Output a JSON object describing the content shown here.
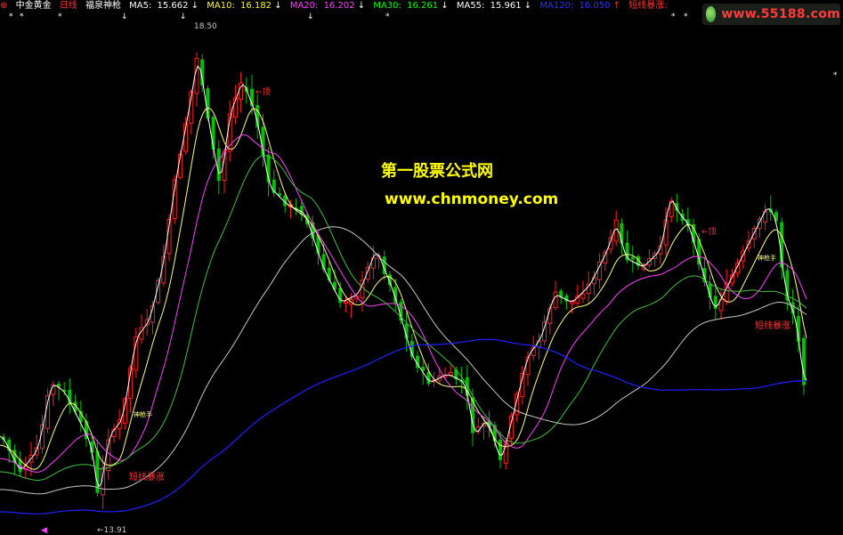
{
  "header": {
    "marker": "⊕",
    "stock_name": "中金黄金",
    "period": "日线",
    "indicator_name": "福泉神枪",
    "ma": [
      {
        "label": "MA5:",
        "value": "15.662",
        "arrow": "↓",
        "color": "#ffffff"
      },
      {
        "label": "MA10:",
        "value": "16.182",
        "arrow": "↓",
        "color": "#ffff00"
      },
      {
        "label": "MA20:",
        "value": "16.202",
        "arrow": "↓",
        "color": "#ff40ff"
      },
      {
        "label": "MA30:",
        "value": "16.261",
        "arrow": "↓",
        "color": "#00ff00"
      },
      {
        "label": "MA55:",
        "value": "15.961",
        "arrow": "↓",
        "color": "#d0d0d0"
      },
      {
        "label": "MA120:",
        "value": "16.050",
        "arrow": "↑",
        "color": "#3030ff"
      }
    ],
    "signal": "短线暴涨:"
  },
  "logo": {
    "text": "www.55188.com"
  },
  "watermark": {
    "title": "第一股票公式网",
    "url": "www.chnmoney.com"
  },
  "annotations": {
    "high_price": "18.50",
    "low_price": "←13.91",
    "top_label_1": "←顶",
    "top_label_2": "←顶",
    "surge_label_1": "短线暴涨",
    "surge_label_2": "短线暴涨",
    "gun_label_1": "神枪手",
    "gun_label_2": "神枪手",
    "star": "*",
    "down_arrow": "↓",
    "left_marker": "◀"
  },
  "colors": {
    "up": "#ff2020",
    "down": "#00c000",
    "ma5": "#ffffff",
    "ma10": "#ffff80",
    "ma20": "#ff40ff",
    "ma30": "#40c040",
    "ma55": "#c8c8c8",
    "ma120": "#2020ff",
    "text_red": "#ff3030"
  }
}
